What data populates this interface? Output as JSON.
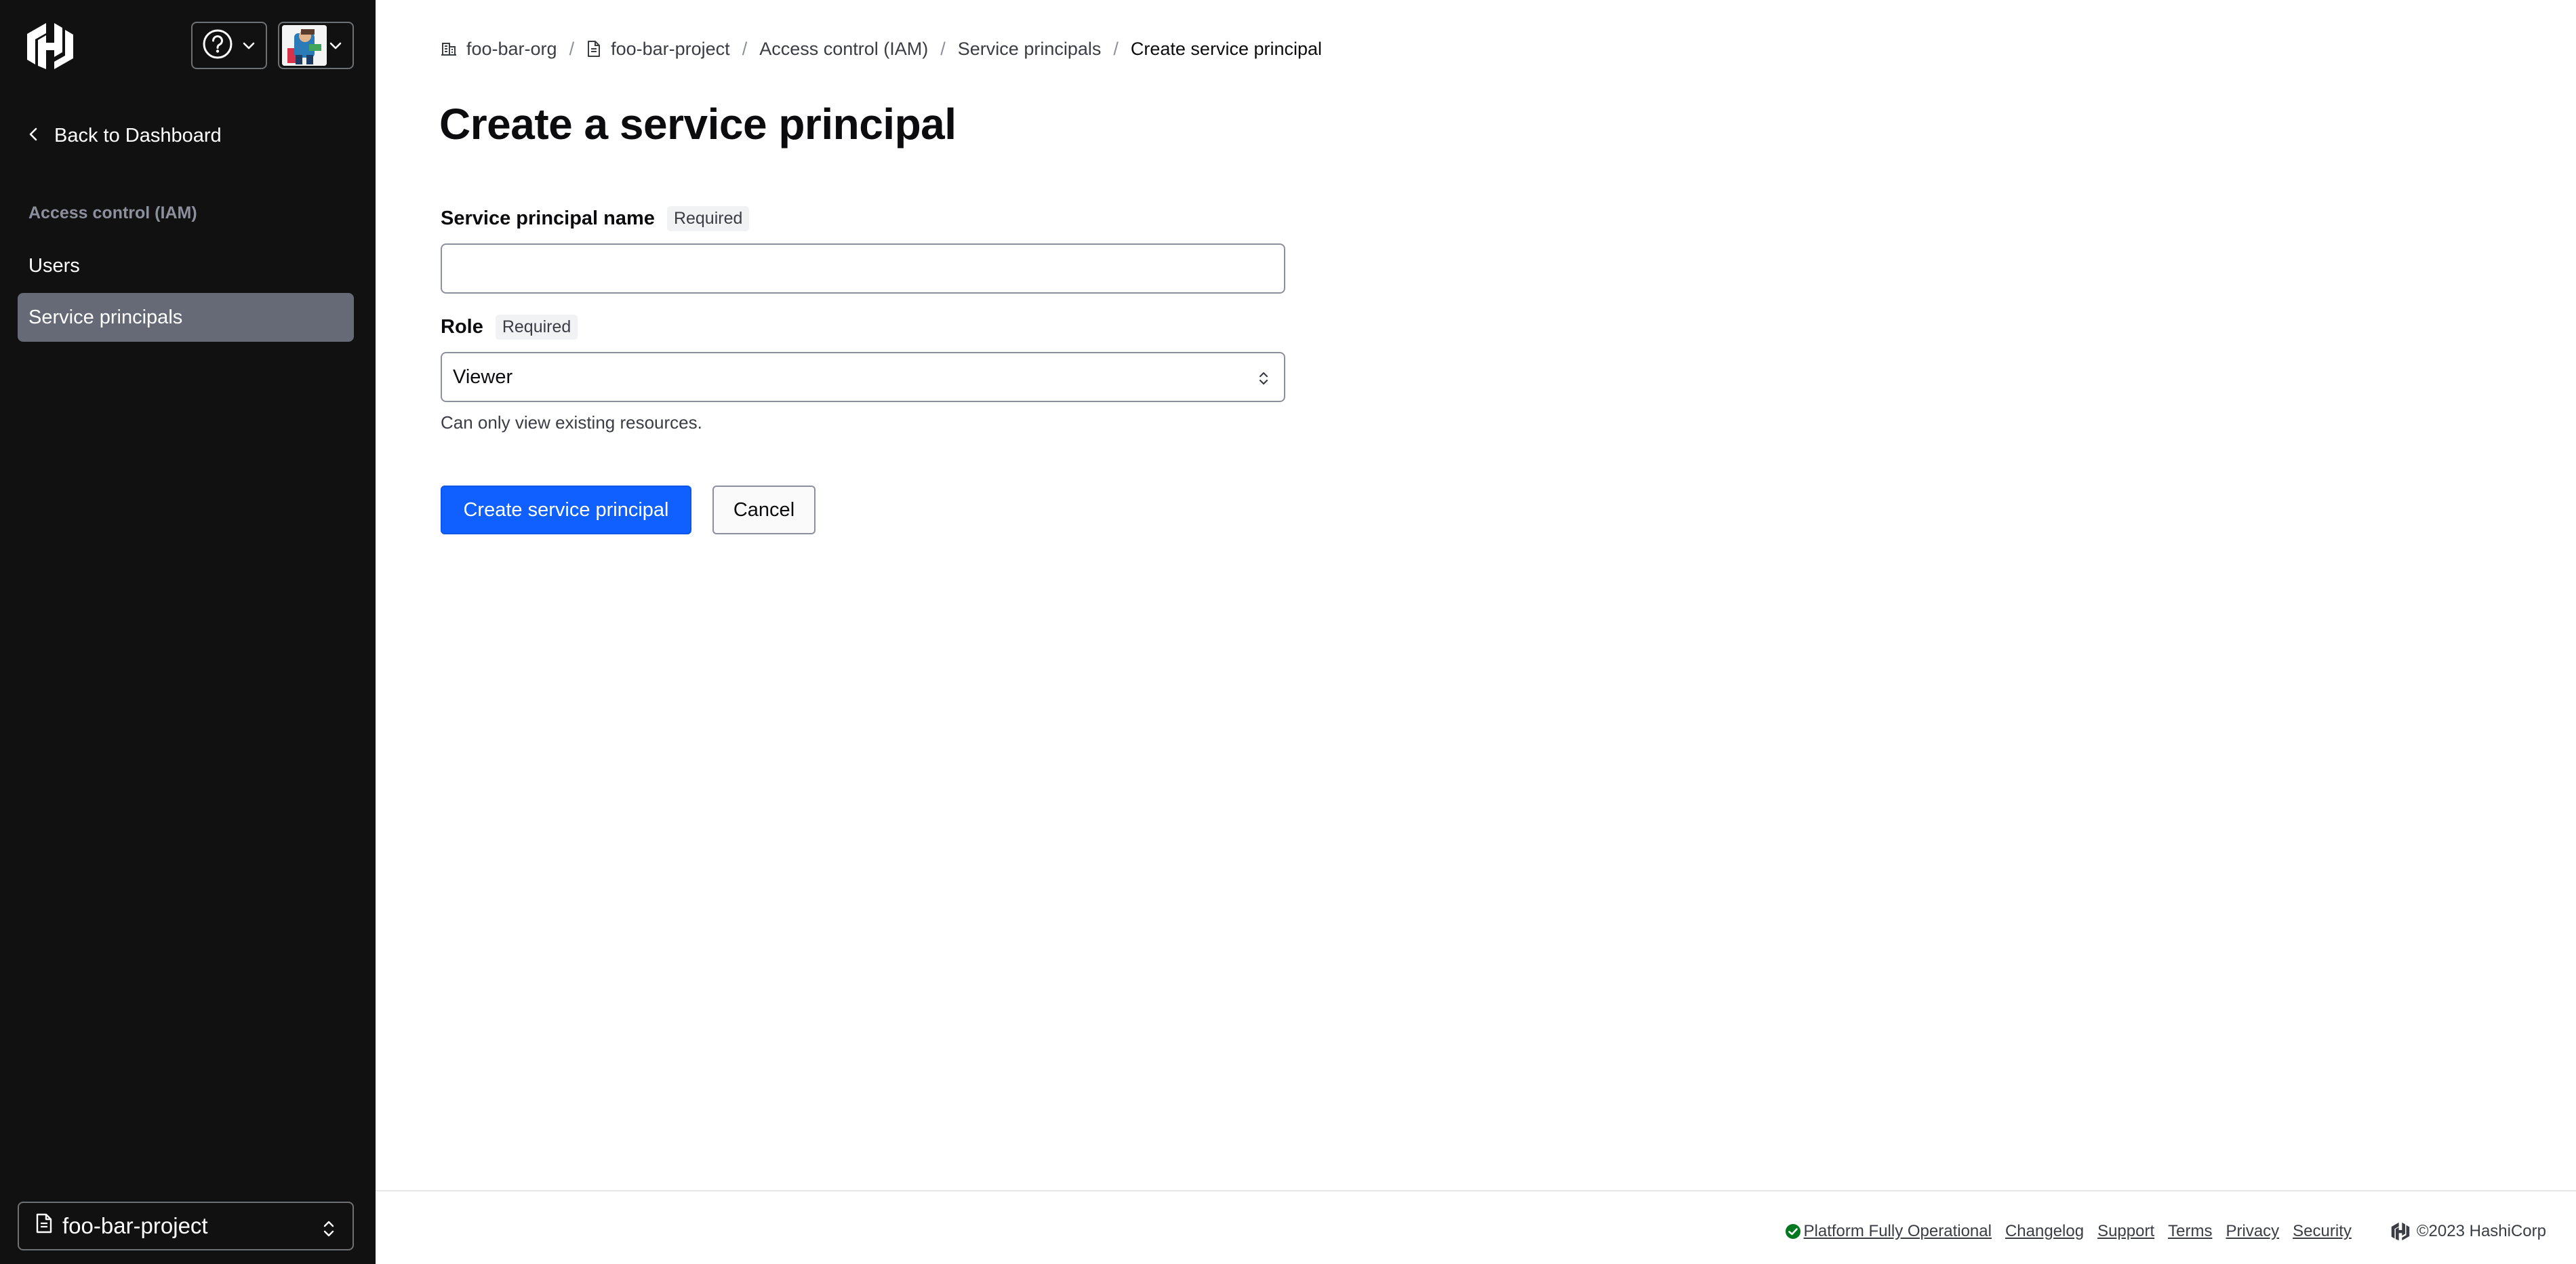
{
  "sidebar": {
    "logo_icon": "hashicorp-logo-icon",
    "help_icon": "help-circle-icon",
    "back_label": "Back to Dashboard",
    "section_label": "Access control (IAM)",
    "items": [
      {
        "label": "Users",
        "active": false
      },
      {
        "label": "Service principals",
        "active": true
      }
    ],
    "project_switcher": {
      "label": "foo-bar-project"
    }
  },
  "breadcrumb": {
    "items": [
      {
        "label": "foo-bar-org",
        "icon": "org-icon"
      },
      {
        "label": "foo-bar-project",
        "icon": "file-icon"
      },
      {
        "label": "Access control (IAM)"
      },
      {
        "label": "Service principals"
      },
      {
        "label": "Create service principal"
      }
    ],
    "separator": "/"
  },
  "page": {
    "title": "Create a service principal"
  },
  "form": {
    "name_field": {
      "label": "Service principal name",
      "required_badge": "Required",
      "value": "",
      "placeholder": ""
    },
    "role_field": {
      "label": "Role",
      "required_badge": "Required",
      "selected": "Viewer",
      "helper_text": "Can only view existing resources."
    },
    "submit_label": "Create service principal",
    "cancel_label": "Cancel"
  },
  "footer": {
    "status_label": "Platform Fully Operational",
    "links": [
      "Changelog",
      "Support",
      "Terms",
      "Privacy",
      "Security"
    ],
    "copyright": "©2023 HashiCorp"
  },
  "colors": {
    "sidebar_bg": "#111111",
    "active_nav": "#656a76",
    "primary": "#1060ff",
    "status_ok": "#00781e"
  }
}
